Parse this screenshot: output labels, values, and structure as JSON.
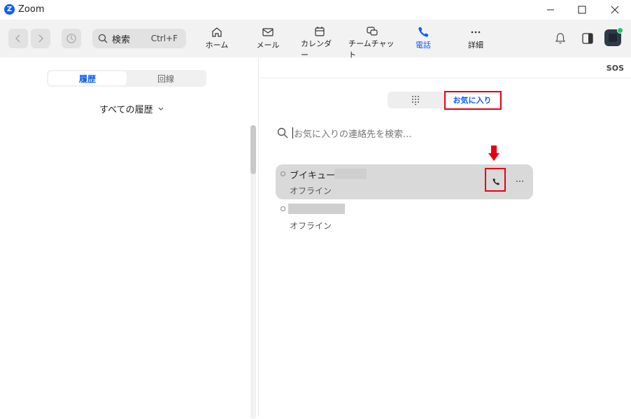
{
  "window": {
    "title": "Zoom",
    "logo_letter": "Z",
    "controls": [
      "minimize-icon",
      "maximize-icon",
      "close-icon"
    ]
  },
  "toolbar": {
    "search_label": "検索",
    "search_shortcut": "Ctrl+F",
    "tabs": [
      {
        "label": "ホーム",
        "icon": "home-icon"
      },
      {
        "label": "メール",
        "icon": "mail-icon"
      },
      {
        "label": "カレンダー",
        "icon": "calendar-icon"
      },
      {
        "label": "チームチャット",
        "icon": "chat-icon"
      },
      {
        "label": "電話",
        "icon": "phone-icon",
        "active": true
      },
      {
        "label": "詳細",
        "icon": "more-dots-icon"
      }
    ],
    "accent": "#0b5cff",
    "presence_color": "#22c55e"
  },
  "left_pane": {
    "segments": [
      {
        "label": "履歴",
        "selected": true
      },
      {
        "label": "回線",
        "selected": false
      }
    ],
    "filter_label": "すべての履歴"
  },
  "right_pane": {
    "sos_label": "SOS",
    "segments": [
      {
        "label": "",
        "icon": "dialpad-icon"
      },
      {
        "label": "お気に入り",
        "selected": true
      }
    ],
    "search_placeholder": "お気に入りの連絡先を検索...",
    "contacts": [
      {
        "name": "ブイキューブ",
        "status": "オフライン",
        "highlighted": true
      },
      {
        "name": "",
        "status": "オフライン",
        "highlighted": false
      }
    ],
    "more_label": "···",
    "annotation_color": "#e60012"
  }
}
